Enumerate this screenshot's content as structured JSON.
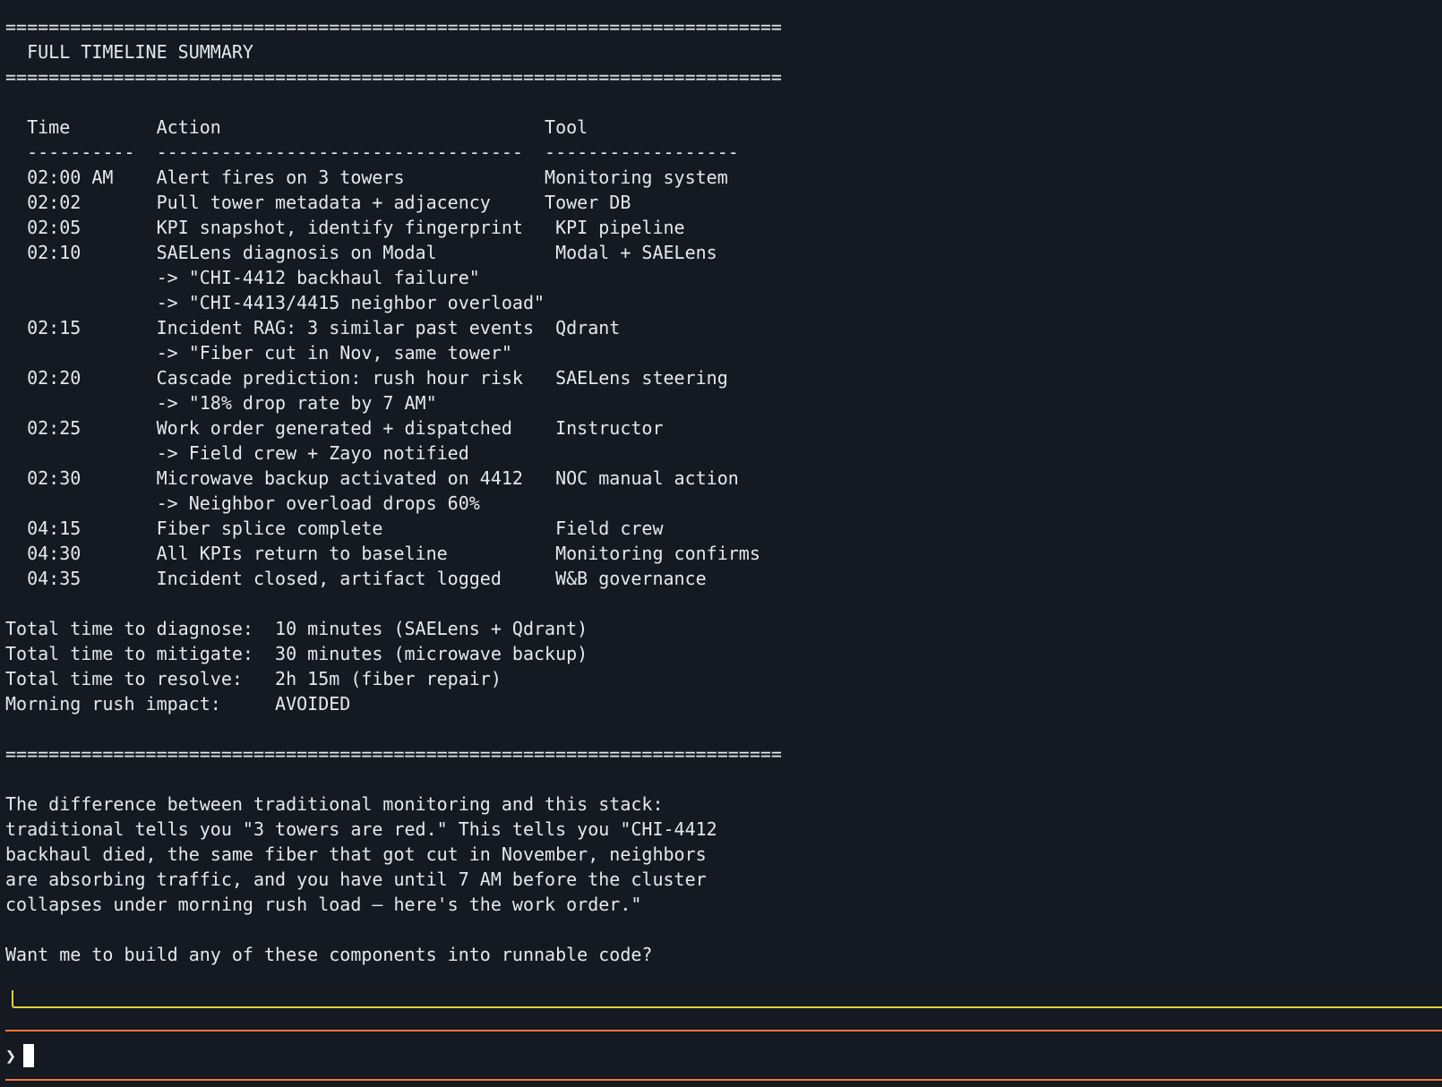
{
  "lines": [
    "========================================================================",
    "  FULL TIMELINE SUMMARY",
    "========================================================================",
    "",
    "  Time        Action                              Tool",
    "  ----------  ----------------------------------  ------------------",
    "  02:00 AM    Alert fires on 3 towers             Monitoring system",
    "  02:02       Pull tower metadata + adjacency     Tower DB",
    "  02:05       KPI snapshot, identify fingerprint   KPI pipeline",
    "  02:10       SAELens diagnosis on Modal           Modal + SAELens",
    "              -> \"CHI-4412 backhaul failure\"",
    "              -> \"CHI-4413/4415 neighbor overload\"",
    "  02:15       Incident RAG: 3 similar past events  Qdrant",
    "              -> \"Fiber cut in Nov, same tower\"",
    "  02:20       Cascade prediction: rush hour risk   SAELens steering",
    "              -> \"18% drop rate by 7 AM\"",
    "  02:25       Work order generated + dispatched    Instructor",
    "              -> Field crew + Zayo notified",
    "  02:30       Microwave backup activated on 4412   NOC manual action",
    "              -> Neighbor overload drops 60%",
    "  04:15       Fiber splice complete                Field crew",
    "  04:30       All KPIs return to baseline          Monitoring confirms",
    "  04:35       Incident closed, artifact logged     W&B governance",
    "",
    "Total time to diagnose:  10 minutes (SAELens + Qdrant)",
    "Total time to mitigate:  30 minutes (microwave backup)",
    "Total time to resolve:   2h 15m (fiber repair)",
    "Morning rush impact:     AVOIDED",
    "",
    "========================================================================",
    "",
    "The difference between traditional monitoring and this stack:",
    "traditional tells you \"3 towers are red.\" This tells you \"CHI-4412",
    "backhaul died, the same fiber that got cut in November, neighbors",
    "are absorbing traffic, and you have until 7 AM before the cluster",
    "collapses under morning rush load — here's the work order.\"",
    "",
    "Want me to build any of these components into runnable code?"
  ],
  "prompt": {
    "symbol": "❯",
    "value": ""
  },
  "colors": {
    "background": "#151922",
    "text": "#e6e8ec",
    "frame_border": "#e2d13a",
    "input_rule": "#f07a3c"
  }
}
